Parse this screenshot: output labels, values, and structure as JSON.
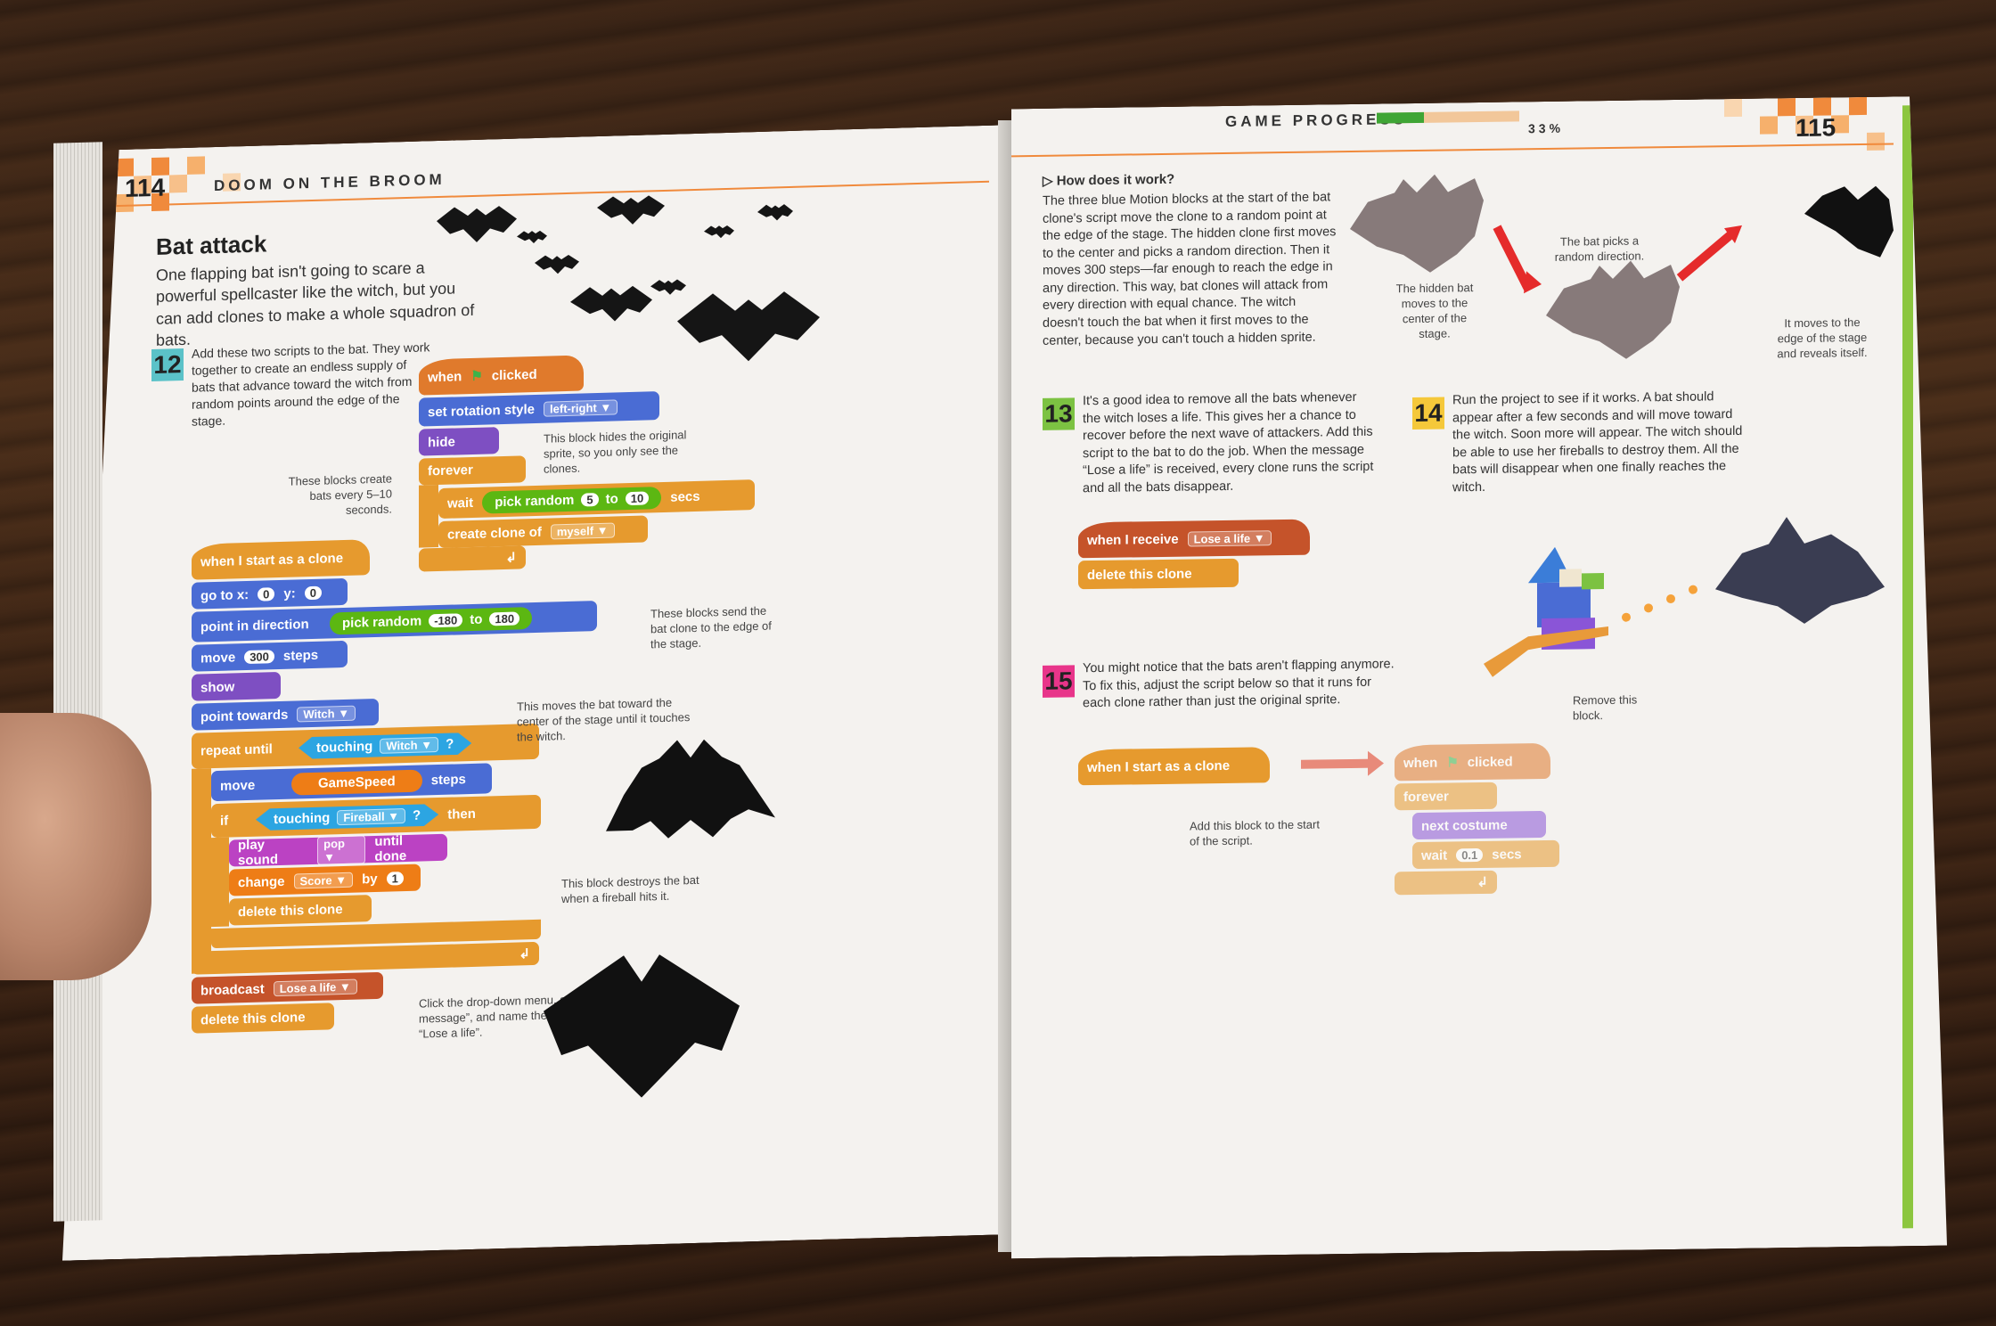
{
  "left_page": {
    "page_number": "114",
    "header": "DOOM ON THE BROOM",
    "section_title": "Bat attack",
    "intro": "One flapping bat isn't going to scare a powerful spellcaster like the witch, but you can add clones to make a whole squadron of bats.",
    "step12": {
      "number": "12",
      "text": "Add these two scripts to the bat. They work together to create an endless supply of bats that advance toward the witch from random points around the edge of the stage."
    },
    "script1": {
      "when_clicked": [
        "when",
        "clicked"
      ],
      "set_rotation": "set rotation style",
      "rotation_value": "left-right ▼",
      "hide": "hide",
      "forever": "forever",
      "wait": "wait",
      "pick_random": "pick random",
      "pick_from": "5",
      "pick_to_label": "to",
      "pick_to": "10",
      "secs": "secs",
      "create_clone": "create clone of",
      "clone_target": "myself ▼"
    },
    "script2": {
      "hat": "when I start as a clone",
      "go_to": "go to x:",
      "go_x": "0",
      "go_y_label": "y:",
      "go_y": "0",
      "point_dir": "point in direction",
      "pick_random": "pick random",
      "dir_from": "-180",
      "dir_to_label": "to",
      "dir_to": "180",
      "move": "move",
      "move_steps": "300",
      "steps": "steps",
      "show": "show",
      "point_towards": "point towards",
      "towards_target": "Witch ▼",
      "repeat_until": "repeat until",
      "touching": "touching",
      "touching_witch": "Witch ▼",
      "q": "?",
      "move2": "move",
      "gamespeed": "GameSpeed",
      "steps2": "steps",
      "if": "if",
      "touching2": "touching",
      "fireball": "Fireball ▼",
      "then": "then",
      "play_sound": "play sound",
      "sound": "pop ▼",
      "until_done": "until done",
      "change": "change",
      "score": "Score ▼",
      "by": "by",
      "by_val": "1",
      "delete": "delete this clone",
      "broadcast": "broadcast",
      "lose_life": "Lose a life ▼",
      "delete2": "delete this clone"
    },
    "annotations": {
      "hide_note": "This block hides the original sprite, so you only see the clones.",
      "every_note": "These blocks create bats every 5–10 seconds.",
      "edge_note": "These blocks send the bat clone to the edge of the stage.",
      "toward_note": "This moves the bat toward the center of the stage until it touches the witch.",
      "destroy_note": "This block destroys the bat when a fireball hits it.",
      "dropdown_note": "Click the drop-down menu, select “New message”, and name the message “Lose a life”."
    }
  },
  "right_page": {
    "page_number": "115",
    "header": "GAME PROGRESS",
    "progress_percent": "33%",
    "progress_fraction": 0.33,
    "how_title": "▷ How does it work?",
    "how_text": "The three blue Motion blocks at the start of the bat clone's script move the clone to a random point at the edge of the stage. The hidden clone first moves to the center and picks a random direction. Then it moves 300 steps—far enough to reach the edge in any direction. This way, bat clones will attack from every direction with equal chance. The witch doesn't touch the bat when it first moves to the center, because you can't touch a hidden sprite.",
    "diagram_notes": {
      "hidden": "The hidden bat moves to the center of the stage.",
      "picks": "The bat picks a random direction.",
      "reveals": "It moves to the edge of the stage and reveals itself."
    },
    "step13": {
      "number": "13",
      "text": "It's a good idea to remove all the bats whenever the witch loses a life. This gives her a chance to recover before the next wave of attackers. Add this script to the bat to do the job. When the message “Lose a life” is received, every clone runs the script and all the bats disappear.",
      "hat": "when I receive",
      "msg": "Lose a life ▼",
      "delete": "delete this clone"
    },
    "step14": {
      "number": "14",
      "text": "Run the project to see if it works. A bat should appear after a few seconds and will move toward the witch. Soon more will appear. The witch should be able to use her fireballs to destroy them. All the bats will disappear when one finally reaches the witch."
    },
    "step15": {
      "number": "15",
      "text": "You might notice that the bats aren't flapping anymore. To fix this, adjust the script below so that it runs for each clone rather than just the original sprite.",
      "hat": "when I start as a clone",
      "add_note": "Add this block to the start of the script.",
      "remove_note": "Remove this block.",
      "old_when": "when",
      "old_clicked": "clicked",
      "forever": "forever",
      "next_costume": "next costume",
      "wait": "wait",
      "wait_val": "0.1",
      "secs": "secs"
    }
  },
  "colors": {
    "events": "#e8a13a",
    "control": "#f0a830",
    "motion": "#4a6cd4",
    "looks": "#8a55d7",
    "operators": "#5cb712",
    "sensing": "#2ca5e2",
    "sound": "#bb42c3",
    "data": "#ee7d16",
    "pixel_orange": "#f5a25a",
    "progress_green": "#3fa535",
    "progress_track": "#f2c79a"
  }
}
